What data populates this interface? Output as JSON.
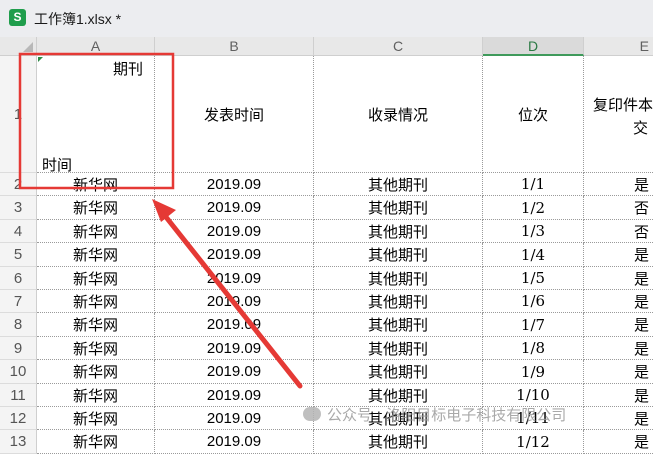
{
  "window": {
    "app_icon": "S",
    "title": "工作簿1.xlsx *"
  },
  "columns": [
    "A",
    "B",
    "C",
    "D",
    "E"
  ],
  "selected_column": "D",
  "header_row": {
    "row_number": "1",
    "diagonal_top": "期刊",
    "diagonal_bottom": "时间",
    "b": "发表时间",
    "c": "收录情况",
    "d": "位次",
    "e_line1": "复印件本",
    "e_line2": "交"
  },
  "rows": [
    {
      "n": "2",
      "a": "新华网",
      "b": "2019.09",
      "c": "其他期刊",
      "d": "1/1",
      "e": "是"
    },
    {
      "n": "3",
      "a": "新华网",
      "b": "2019.09",
      "c": "其他期刊",
      "d": "1/2",
      "e": "否"
    },
    {
      "n": "4",
      "a": "新华网",
      "b": "2019.09",
      "c": "其他期刊",
      "d": "1/3",
      "e": "否"
    },
    {
      "n": "5",
      "a": "新华网",
      "b": "2019.09",
      "c": "其他期刊",
      "d": "1/4",
      "e": "是"
    },
    {
      "n": "6",
      "a": "新华网",
      "b": "2019.09",
      "c": "其他期刊",
      "d": "1/5",
      "e": "是"
    },
    {
      "n": "7",
      "a": "新华网",
      "b": "2019.09",
      "c": "其他期刊",
      "d": "1/6",
      "e": "是"
    },
    {
      "n": "8",
      "a": "新华网",
      "b": "2019.09",
      "c": "其他期刊",
      "d": "1/7",
      "e": "是"
    },
    {
      "n": "9",
      "a": "新华网",
      "b": "2019.09",
      "c": "其他期刊",
      "d": "1/8",
      "e": "是"
    },
    {
      "n": "10",
      "a": "新华网",
      "b": "2019.09",
      "c": "其他期刊",
      "d": "1/9",
      "e": "是"
    },
    {
      "n": "11",
      "a": "新华网",
      "b": "2019.09",
      "c": "其他期刊",
      "d": "1/10",
      "e": "是"
    },
    {
      "n": "12",
      "a": "新华网",
      "b": "2019.09",
      "c": "其他期刊",
      "d": "1/11",
      "e": "是"
    },
    {
      "n": "13",
      "a": "新华网",
      "b": "2019.09",
      "c": "其他期刊",
      "d": "1/12",
      "e": "是"
    }
  ],
  "watermark": "公众号 · 洛阳目标电子科技有限公司",
  "colors": {
    "highlight": "#e53935",
    "selected_col": "#3f9a5b",
    "app_icon": "#1f9d4c"
  }
}
